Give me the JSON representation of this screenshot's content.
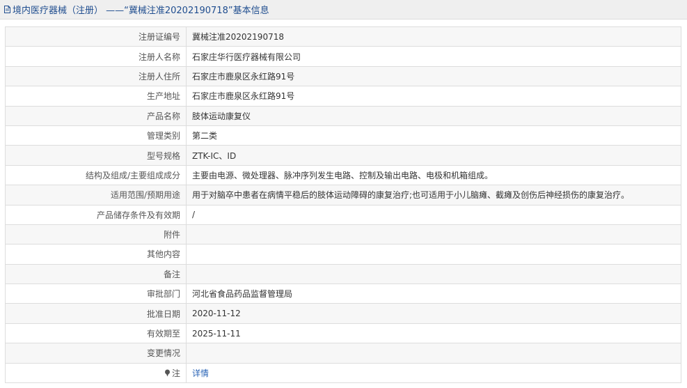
{
  "header": {
    "title": "境内医疗器械（注册） ——“冀械注准20202190718”基本信息"
  },
  "rows": [
    {
      "label": "注册证编号",
      "value": "冀械注准20202190718"
    },
    {
      "label": "注册人名称",
      "value": "石家庄华行医疗器械有限公司"
    },
    {
      "label": "注册人住所",
      "value": "石家庄市鹿泉区永红路91号"
    },
    {
      "label": "生产地址",
      "value": "石家庄市鹿泉区永红路91号"
    },
    {
      "label": "产品名称",
      "value": "肢体运动康复仪"
    },
    {
      "label": "管理类别",
      "value": "第二类"
    },
    {
      "label": "型号规格",
      "value": "ZTK-IC、ID"
    },
    {
      "label": "结构及组成/主要组成成分",
      "value": "主要由电源、微处理器、脉冲序列发生电路、控制及输出电路、电极和机箱组成。"
    },
    {
      "label": "适用范围/预期用途",
      "value": "用于对脑卒中患者在病情平稳后的肢体运动障碍的康复治疗;也可适用于小儿脑瘫、截瘫及创伤后神经损伤的康复治疗。"
    },
    {
      "label": "产品储存条件及有效期",
      "value": "/"
    },
    {
      "label": "附件",
      "value": ""
    },
    {
      "label": "其他内容",
      "value": ""
    },
    {
      "label": "备注",
      "value": ""
    },
    {
      "label": "审批部门",
      "value": "河北省食品药品监督管理局"
    },
    {
      "label": "批准日期",
      "value": "2020-11-12"
    },
    {
      "label": "有效期至",
      "value": "2025-11-11"
    },
    {
      "label": "变更情况",
      "value": ""
    },
    {
      "label": "注",
      "value": "详情"
    }
  ],
  "icons": {
    "title_icon": "document-icon",
    "note_icon": "pin-icon"
  },
  "colors": {
    "title_text": "#1f4d8f",
    "link": "#2a64b6"
  }
}
